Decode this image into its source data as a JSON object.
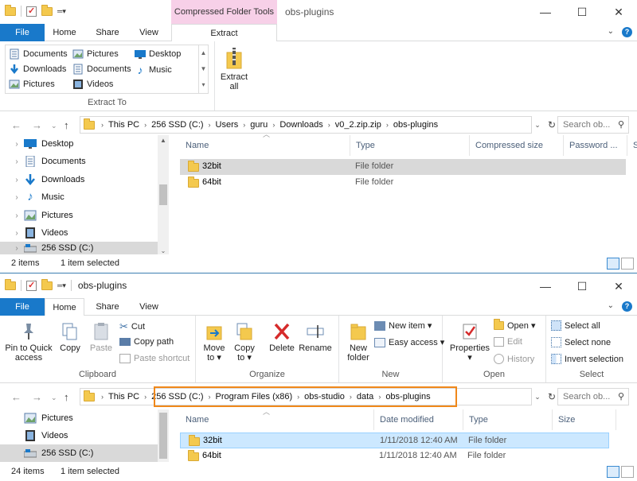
{
  "colors": {
    "file_tab": "#1979ca",
    "context_tab": "#f7d0e8",
    "highlight": "#f0881a",
    "selected_blue": "#cce8ff"
  },
  "top": {
    "context_tab": "Compressed Folder Tools",
    "title": "obs-plugins",
    "tabs": {
      "file": "File",
      "home": "Home",
      "share": "Share",
      "view": "View",
      "extract": "Extract"
    },
    "extract_to": {
      "items": [
        "Documents",
        "Pictures",
        "Desktop",
        "Downloads",
        "Documents",
        "Music",
        "Pictures",
        "Videos"
      ],
      "label": "Extract To"
    },
    "extract_all": {
      "line1": "Extract",
      "line2": "all"
    },
    "breadcrumbs": [
      "This PC",
      "256 SSD (C:)",
      "Users",
      "guru",
      "Downloads",
      "v0_2.zip.zip",
      "obs-plugins"
    ],
    "search_placeholder": "Search ob...",
    "nav": [
      "Desktop",
      "Documents",
      "Downloads",
      "Music",
      "Pictures",
      "Videos",
      "256 SSD (C:)"
    ],
    "columns": [
      "Name",
      "Type",
      "Compressed size",
      "Password ...",
      "Si"
    ],
    "files": [
      {
        "name": "32bit",
        "type": "File folder"
      },
      {
        "name": "64bit",
        "type": "File folder"
      }
    ],
    "status": {
      "count": "2 items",
      "selected": "1 item selected"
    }
  },
  "bottom": {
    "title": "obs-plugins",
    "tabs": {
      "file": "File",
      "home": "Home",
      "share": "Share",
      "view": "View"
    },
    "clipboard": {
      "pin_line1": "Pin to Quick",
      "pin_line2": "access",
      "copy": "Copy",
      "paste": "Paste",
      "cut": "Cut",
      "copy_path": "Copy path",
      "paste_shortcut": "Paste shortcut",
      "label": "Clipboard"
    },
    "organize": {
      "move_line1": "Move",
      "move_line2": "to ▾",
      "copy_line1": "Copy",
      "copy_line2": "to ▾",
      "delete": "Delete",
      "rename": "Rename",
      "label": "Organize"
    },
    "new": {
      "folder_line1": "New",
      "folder_line2": "folder",
      "new_item": "New item ▾",
      "easy_access": "Easy access ▾",
      "label": "New"
    },
    "open": {
      "properties": "Properties",
      "open": "Open ▾",
      "edit": "Edit",
      "history": "History",
      "label": "Open"
    },
    "select": {
      "all": "Select all",
      "none": "Select none",
      "invert": "Invert selection",
      "label": "Select"
    },
    "breadcrumbs": [
      "This PC",
      "256 SSD (C:)",
      "Program Files (x86)",
      "obs-studio",
      "data",
      "obs-plugins"
    ],
    "search_placeholder": "Search ob...",
    "nav": [
      "Pictures",
      "Videos",
      "256 SSD (C:)"
    ],
    "columns": [
      "Name",
      "Date modified",
      "Type",
      "Size"
    ],
    "files": [
      {
        "name": "32bit",
        "date": "1/11/2018 12:40 AM",
        "type": "File folder"
      },
      {
        "name": "64bit",
        "date": "1/11/2018 12:40 AM",
        "type": "File folder"
      }
    ],
    "status": {
      "count": "24 items",
      "selected": "1 item selected"
    }
  }
}
